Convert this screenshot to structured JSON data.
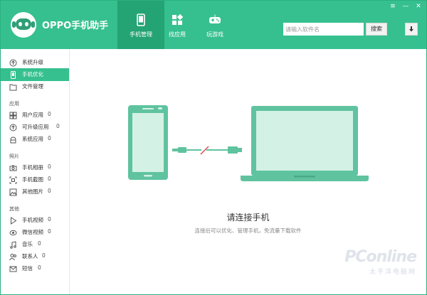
{
  "app": {
    "title": "OPPO手机助手"
  },
  "nav": {
    "tabs": [
      {
        "label": "手机管理",
        "active": true
      },
      {
        "label": "找应用",
        "active": false
      },
      {
        "label": "玩游戏",
        "active": false
      }
    ]
  },
  "search": {
    "placeholder": "请输入软件名",
    "button_label": "搜索"
  },
  "window_controls": {
    "menu": "≡",
    "minimize": "—",
    "close": "✕"
  },
  "sidebar": {
    "top_items": [
      {
        "label": "系统升级",
        "icon": "upgrade-icon"
      },
      {
        "label": "手机优化",
        "icon": "phone-icon",
        "active": true
      },
      {
        "label": "文件管理",
        "icon": "folder-icon"
      }
    ],
    "apps_group": {
      "title": "应用",
      "items": [
        {
          "label": "用户应用",
          "count": "0"
        },
        {
          "label": "可升级应用",
          "count": "0"
        },
        {
          "label": "系统应用",
          "count": "0"
        }
      ]
    },
    "photos_group": {
      "title": "照片",
      "items": [
        {
          "label": "手机相册",
          "count": "0"
        },
        {
          "label": "手机截图",
          "count": "0"
        },
        {
          "label": "其他图片",
          "count": "0"
        }
      ]
    },
    "other_group": {
      "title": "其他",
      "items": [
        {
          "label": "手机视频",
          "count": "0"
        },
        {
          "label": "微信视频",
          "count": "0"
        },
        {
          "label": "音乐",
          "count": "0"
        },
        {
          "label": "联系人",
          "count": "0"
        },
        {
          "label": "短信",
          "count": "0"
        }
      ]
    }
  },
  "main": {
    "title": "请连接手机",
    "subtitle": "连接后可以优化、管理手机，免流量下载软件"
  },
  "watermark": {
    "brand": "PConline",
    "tagline": "太平洋电脑网"
  },
  "colors": {
    "accent": "#36c08f",
    "accent_dark": "#24a374",
    "illustration": "#5fc3a0",
    "illustration_light": "#d4f1e6"
  }
}
